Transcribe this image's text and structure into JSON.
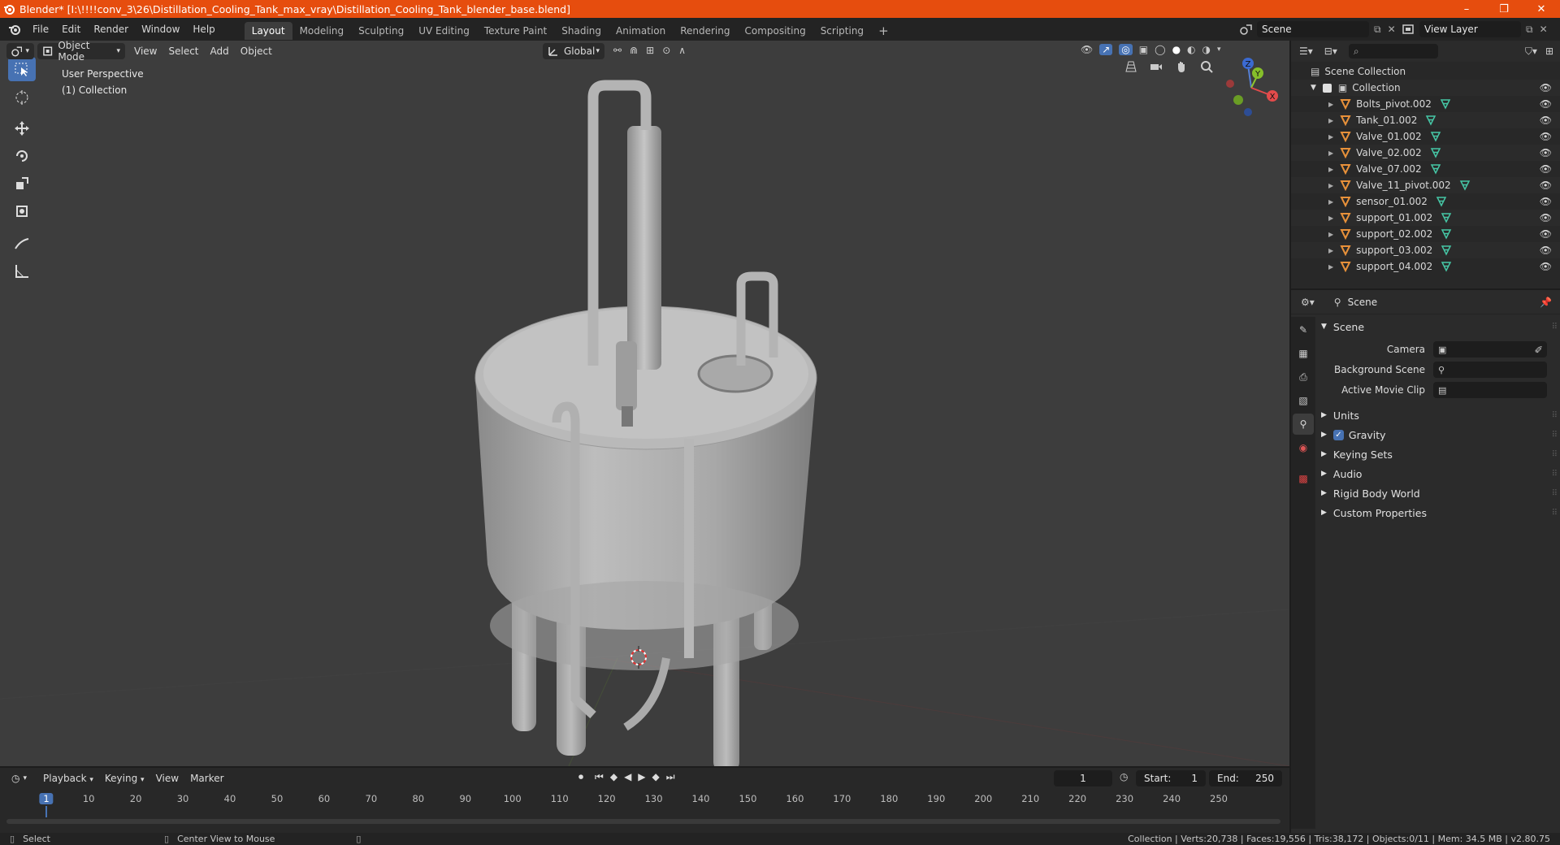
{
  "window": {
    "title": "Blender* [I:\\!!!!conv_3\\26\\Distillation_Cooling_Tank_max_vray\\Distillation_Cooling_Tank_blender_base.blend]",
    "controls": [
      "–",
      "❐",
      "✕"
    ]
  },
  "menu": [
    "File",
    "Edit",
    "Render",
    "Window",
    "Help"
  ],
  "workspaces": [
    "Layout",
    "Modeling",
    "Sculpting",
    "UV Editing",
    "Texture Paint",
    "Shading",
    "Animation",
    "Rendering",
    "Compositing",
    "Scripting"
  ],
  "active_workspace": "Layout",
  "scene_field": "Scene",
  "view_layer_field": "View Layer",
  "viewport": {
    "mode": "Object Mode",
    "menus": [
      "View",
      "Select",
      "Add",
      "Object"
    ],
    "orientation": "Global",
    "overlay_line1": "User Perspective",
    "overlay_line2": "(1) Collection",
    "gizmo_axes": {
      "x": "X",
      "y": "Y",
      "z": "Z"
    }
  },
  "outliner": {
    "root": "Scene Collection",
    "collection": "Collection",
    "objects": [
      "Bolts_pivot.002",
      "Tank_01.002",
      "Valve_01.002",
      "Valve_02.002",
      "Valve_07.002",
      "Valve_11_pivot.002",
      "sensor_01.002",
      "support_01.002",
      "support_02.002",
      "support_03.002",
      "support_04.002"
    ]
  },
  "properties": {
    "header": "Scene",
    "panel": "Scene",
    "camera_label": "Camera",
    "bg_scene_label": "Background Scene",
    "movie_clip_label": "Active Movie Clip",
    "subpanels": [
      "Units",
      "Gravity",
      "Keying Sets",
      "Audio",
      "Rigid Body World",
      "Custom Properties"
    ],
    "gravity_checked": true
  },
  "timeline": {
    "menus": [
      "Playback",
      "Keying",
      "View",
      "Marker"
    ],
    "current_frame": "1",
    "start_label": "Start:",
    "start": "1",
    "end_label": "End:",
    "end": "250",
    "ticks": [
      "1",
      "10",
      "20",
      "30",
      "40",
      "50",
      "60",
      "70",
      "80",
      "90",
      "100",
      "110",
      "120",
      "130",
      "140",
      "150",
      "160",
      "170",
      "180",
      "190",
      "200",
      "210",
      "220",
      "230",
      "240",
      "250"
    ]
  },
  "statusbar": {
    "select": "Select",
    "center_view": "Center View to Mouse",
    "stats": "Collection | Verts:20,738 | Faces:19,556 | Tris:38,172 | Objects:0/11 | Mem: 34.5 MB | v2.80.75"
  },
  "colors": {
    "accent": "#4772b3",
    "titlebar": "#e64d0e",
    "object_icon": "#e8913a",
    "mesh_icon": "#46c7a6"
  }
}
